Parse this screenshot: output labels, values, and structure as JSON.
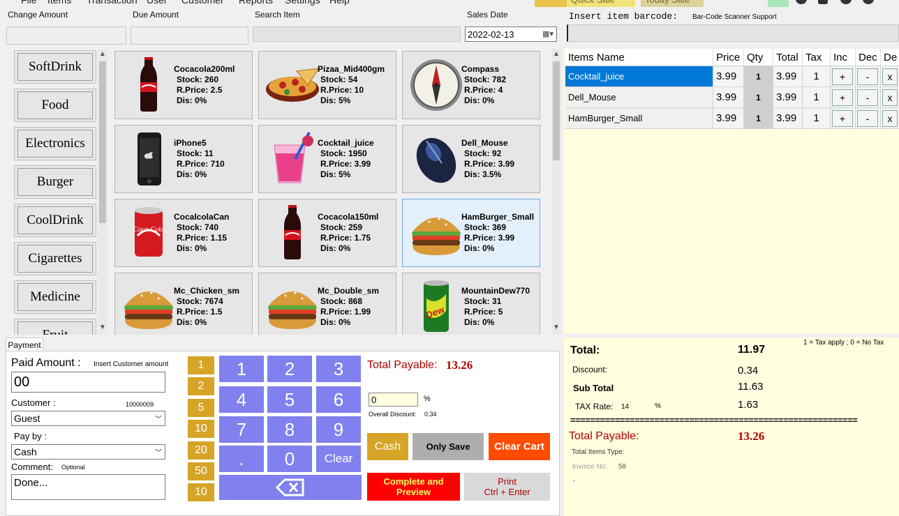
{
  "menu": {
    "items": [
      "File",
      "Items",
      "Transaction",
      "User",
      "Customer",
      "Reports",
      "Settings",
      "Help"
    ],
    "quick_sale": "Quick Sale",
    "today_sale": "Today Sale"
  },
  "top_fields": {
    "change_amount_label": "Change Amount",
    "due_amount_label": "Due Amount",
    "search_item_label": "Search Item",
    "sales_date_label": "Sales Date",
    "sales_date_value": "2022-02-13"
  },
  "barcode": {
    "label": "Insert item barcode:",
    "support": "Bar-Code Scanner Support"
  },
  "categories": [
    "SoftDrink",
    "Food",
    "Electronics",
    "Burger",
    "CoolDrink",
    "Cigarettes",
    "Medicine",
    "Fruit"
  ],
  "products": [
    {
      "name": "Cocacola200ml",
      "stock": "Stock: 260",
      "price": "R.Price: 2.5",
      "dis": "Dis: 0%",
      "icon": "coke-bottle-icon"
    },
    {
      "name": "Pizaa_Mid400gm",
      "stock": "Stock: 54",
      "price": "R.Price: 10",
      "dis": "Dis: 5%",
      "icon": "pizza-icon"
    },
    {
      "name": "Compass",
      "stock": "Stock: 782",
      "price": "R.Price: 4",
      "dis": "Dis: 0%",
      "icon": "compass-icon"
    },
    {
      "name": "iPhone5",
      "stock": "Stock: 11",
      "price": "R.Price: 710",
      "dis": "Dis: 0%",
      "icon": "phone-icon"
    },
    {
      "name": "Cocktail_juice",
      "stock": "Stock: 1950",
      "price": "R.Price: 3.99",
      "dis": "Dis: 5%",
      "icon": "juice-glass-icon"
    },
    {
      "name": "Dell_Mouse",
      "stock": "Stock: 92",
      "price": "R.Price: 3.99",
      "dis": "Dis: 3.5%",
      "icon": "mouse-icon"
    },
    {
      "name": "CocalcolaCan",
      "stock": "Stock: 740",
      "price": "R.Price: 1.15",
      "dis": "Dis: 0%",
      "icon": "soda-can-icon"
    },
    {
      "name": "Cocacola150ml",
      "stock": "Stock: 259",
      "price": "R.Price: 1.75",
      "dis": "Dis: 0%",
      "icon": "coke-bottle-icon"
    },
    {
      "name": "HamBurger_Small",
      "stock": "Stock: 369",
      "price": "R.Price: 3.99",
      "dis": "Dis: 0%",
      "icon": "burger-icon"
    },
    {
      "name": "Mc_Chicken_sm",
      "stock": "Stock: 7674",
      "price": "R.Price: 1.5",
      "dis": "Dis: 0%",
      "icon": "burger-icon"
    },
    {
      "name": "Mc_Double_sm",
      "stock": "Stock: 868",
      "price": "R.Price: 1.99",
      "dis": "Dis: 0%",
      "icon": "burger-icon"
    },
    {
      "name": "MountainDew770",
      "stock": "Stock: 31",
      "price": "R.Price: 5",
      "dis": "Dis: 0%",
      "icon": "dew-can-icon"
    }
  ],
  "cart": {
    "headers": [
      "Items Name",
      "Price",
      "Qty",
      "Total",
      "Tax",
      "Inc",
      "Dec",
      "De"
    ],
    "rows": [
      {
        "name": "Cocktail_juice",
        "price": "3.99",
        "qty": "1",
        "total": "3.99",
        "tax": "1",
        "inc": "+",
        "dec": "-",
        "del": "x"
      },
      {
        "name": "Dell_Mouse",
        "price": "3.99",
        "qty": "1",
        "total": "3.99",
        "tax": "1",
        "inc": "+",
        "dec": "-",
        "del": "x"
      },
      {
        "name": "HamBurger_Small",
        "price": "3.99",
        "qty": "1",
        "total": "3.99",
        "tax": "1",
        "inc": "+",
        "dec": "-",
        "del": "x"
      }
    ]
  },
  "payment": {
    "tab": "Payment",
    "paid_amount_label": "Paid Amount :",
    "insert_customer_amount": "Insert Customer amount",
    "paid_amount_value": "00",
    "customer_label": "Customer :",
    "customer_id": "10000009",
    "customer_value": "Guest",
    "pay_by_label": "Pay by :",
    "pay_by_value": "Cash",
    "comment_label": "Comment:",
    "comment_hint": "Optional",
    "comment_value": "Done...",
    "quick_amounts": [
      "1",
      "2",
      "5",
      "10",
      "20",
      "50",
      "10"
    ],
    "keypad": [
      "1",
      "2",
      "3",
      "4",
      "5",
      "6",
      "7",
      "8",
      "9",
      ".",
      "0",
      "Clear"
    ],
    "total_payable_label": "Total Payable:",
    "total_payable_value": "13.26",
    "discount_input": "0",
    "percent_sign": "%",
    "overall_discount_label": "Overall Discount:",
    "overall_discount_value": "0.34",
    "cash_btn": "Cash",
    "only_save_btn": "Only Save",
    "clear_cart_btn": "Clear Cart",
    "complete_btn_line1": "Complete and",
    "complete_btn_line2": "Preview",
    "print_btn_line1": "Print",
    "print_btn_line2": "Ctrl + Enter"
  },
  "totals": {
    "tax_hint": "1 = Tax apply ; 0 =  No Tax",
    "total_label": "Total:",
    "total_value": "11.97",
    "discount_label": "Discount:",
    "discount_value": "0.34",
    "subtotal_label": "Sub Total",
    "subtotal_value": "11.63",
    "tax_rate_label": "TAX Rate:",
    "tax_rate_value": "14",
    "tax_percent": "%",
    "tax_value": "1.63",
    "separator": "==========================================================",
    "total_payable_label": "Total Payable:",
    "total_payable_value": "13.26",
    "total_items_type_label": "Total Items Type:",
    "invoice_label": "Invoice No:",
    "invoice_value": "58",
    "dot": "."
  },
  "colors": {
    "gold": "#d6a427",
    "keypad": "#8080ee",
    "selected_row": "#0078d7",
    "total_payable": "#b00000",
    "clear_cart": "#ff4c00",
    "complete": "#ff0000"
  }
}
